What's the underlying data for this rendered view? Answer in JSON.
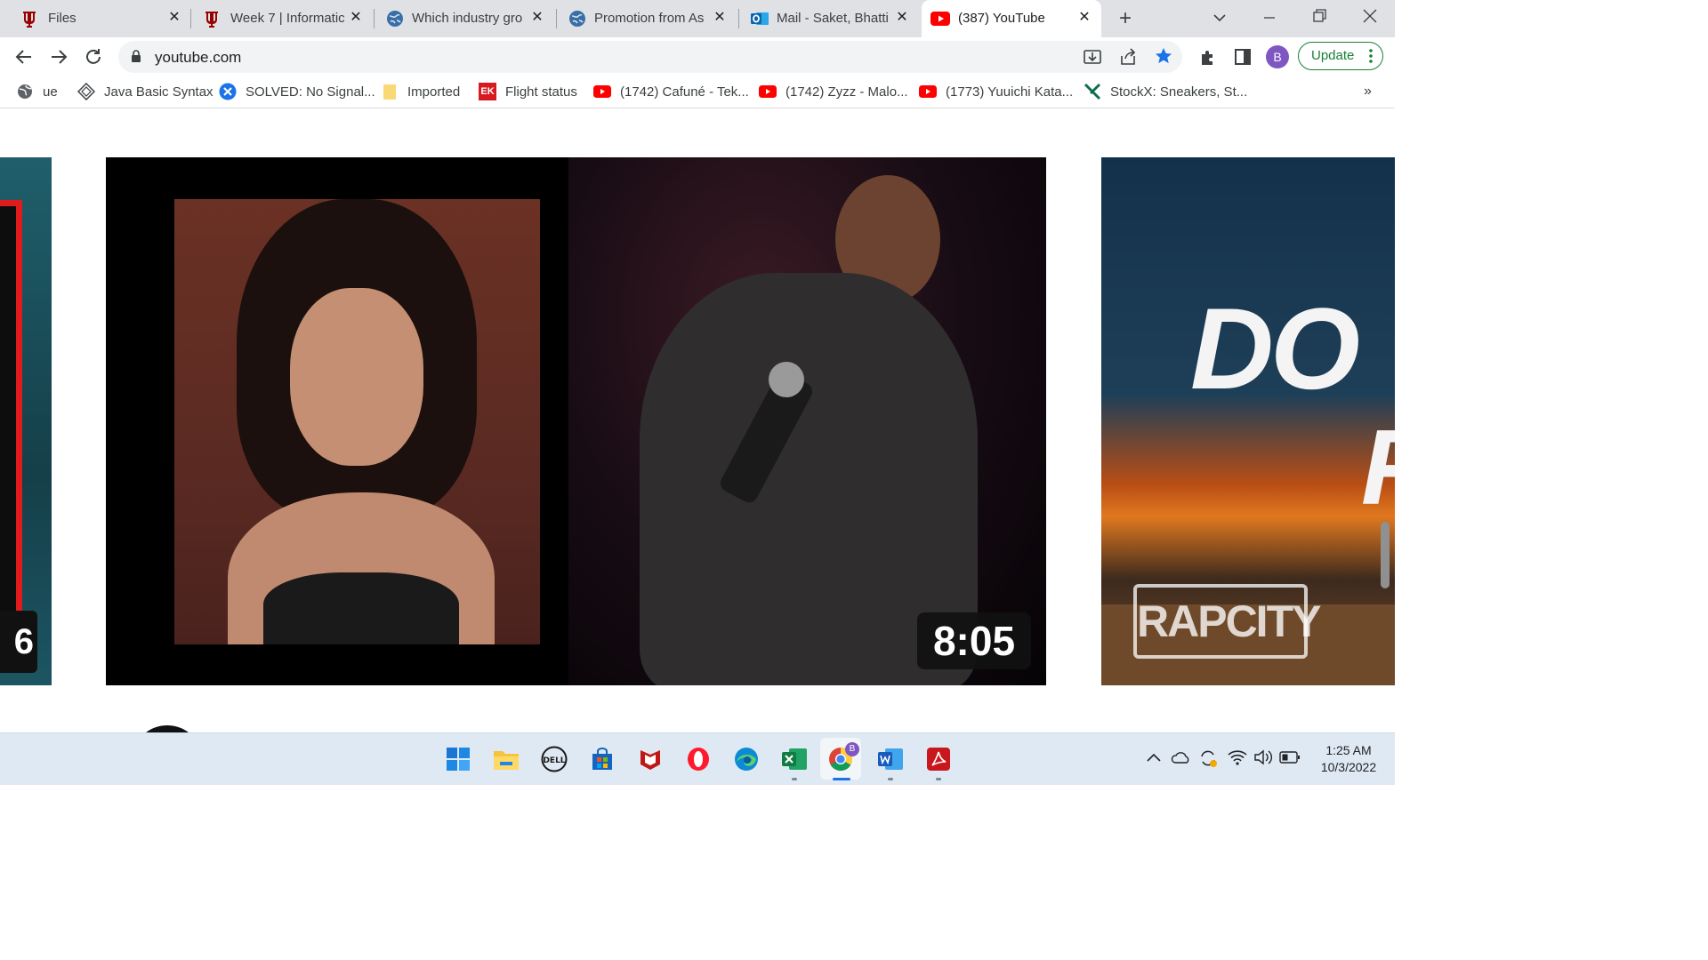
{
  "tabs": [
    {
      "title": "Files",
      "icon": "iu-trident-icon"
    },
    {
      "title": "Week 7 | Informatic",
      "icon": "iu-trident-icon"
    },
    {
      "title": "Which industry gro",
      "icon": "globe-icon"
    },
    {
      "title": "Promotion from As",
      "icon": "globe-icon"
    },
    {
      "title": "Mail - Saket, Bhattip",
      "icon": "outlook-icon"
    },
    {
      "title": "(387) YouTube",
      "icon": "youtube-icon",
      "active": true
    }
  ],
  "address_bar": {
    "url": "youtube.com"
  },
  "toolbar": {
    "profile_initial": "B",
    "update_label": "Update"
  },
  "bookmarks": [
    {
      "label": "ue",
      "icon": "globe-icon"
    },
    {
      "label": "Java Basic Syntax",
      "icon": "diamond-icon"
    },
    {
      "label": "SOLVED: No Signal...",
      "icon": "blue-x-icon"
    },
    {
      "label": "Imported",
      "icon": "folder-icon"
    },
    {
      "label": "Flight status",
      "icon": "ek-icon"
    },
    {
      "label": "(1742) Cafuné - Tek...",
      "icon": "youtube-icon"
    },
    {
      "label": "(1742) Zyzz - Malo...",
      "icon": "youtube-icon"
    },
    {
      "label": "(1773) Yuuichi Kata...",
      "icon": "youtube-icon"
    },
    {
      "label": "StockX: Sneakers, St...",
      "icon": "stockx-icon"
    }
  ],
  "bookmarks_overflow": "»",
  "ek_text": "EK",
  "video": {
    "duration": "8:05",
    "left_duration_fragment": "6",
    "right_thumb_text": "DO",
    "right_thumb_text2": "F",
    "right_thumb_logo": "RAPCITY"
  },
  "taskbar": {
    "apps": [
      "windows-start-icon",
      "file-explorer-icon",
      "dell-icon",
      "microsoft-store-icon",
      "mcafee-icon",
      "opera-icon",
      "edge-icon",
      "excel-icon",
      "chrome-icon",
      "word-icon",
      "acrobat-icon"
    ],
    "dell_text": "DELL",
    "chrome_badge": "B",
    "time": "1:25 AM",
    "date": "10/3/2022"
  },
  "colors": {
    "accent_blue": "#1a73e8",
    "youtube_red": "#ff0000",
    "iu_crimson": "#990000",
    "update_green": "#188038",
    "profile_purple": "#7e57c2"
  }
}
